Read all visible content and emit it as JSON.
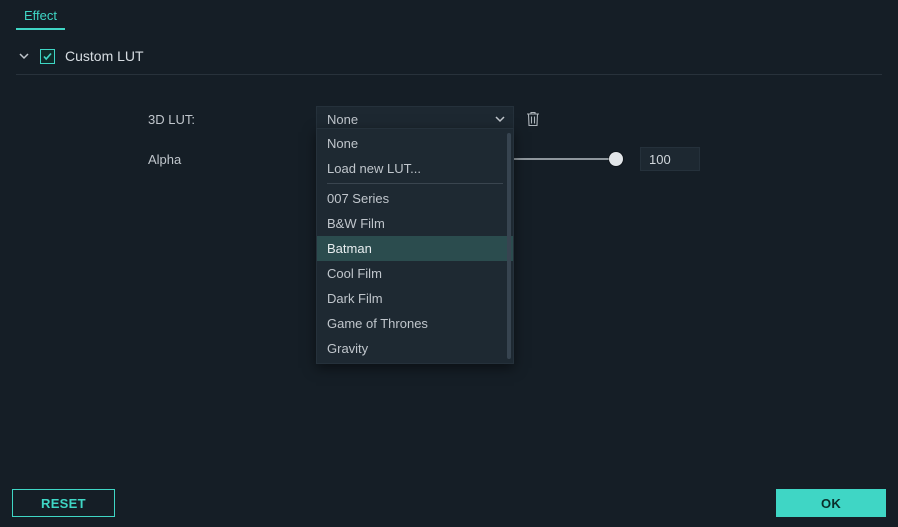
{
  "tabs": {
    "active": "Effect"
  },
  "section": {
    "title": "Custom LUT",
    "checked": true
  },
  "form": {
    "lut_label": "3D LUT:",
    "lut_selected": "None",
    "alpha_label": "Alpha",
    "alpha_value": "100"
  },
  "dropdown": {
    "top": [
      "None",
      "Load new LUT..."
    ],
    "presets": [
      "007 Series",
      "B&W Film",
      "Batman",
      "Cool Film",
      "Dark Film",
      "Game of Thrones",
      "Gravity"
    ],
    "selected": "Batman"
  },
  "footer": {
    "reset": "RESET",
    "ok": "OK"
  },
  "colors": {
    "accent": "#3fd6c5",
    "panel": "#151e26",
    "field": "#1d2831"
  },
  "icons": {
    "chevron_down": "chevron-down-icon",
    "checkbox_tick": "check-icon",
    "trash": "trash-icon",
    "caret": "caret-down-icon"
  }
}
